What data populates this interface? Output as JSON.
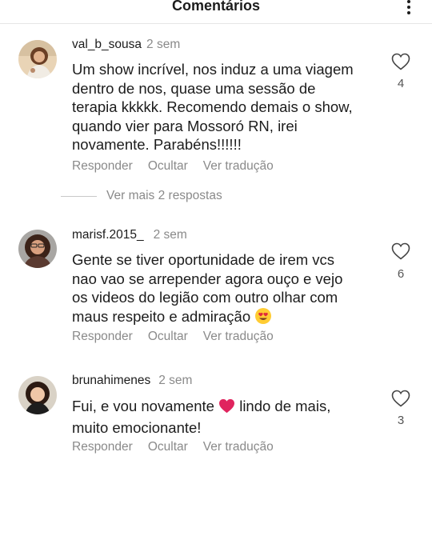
{
  "header": {
    "title": "Comentários"
  },
  "comments": [
    {
      "username": "val_b_sousa",
      "time": "2 sem",
      "text": "Um show incrível, nos induz a uma viagem dentro de nos, quase uma sessão de terapia kkkkk. Recomendo demais o show, quando vier para Mossoró RN, irei novamente. Parabéns!!!!!!",
      "lines": [
        "Um show incrível, nos induz a uma viagem",
        "dentro de nos, quase uma sessão de",
        "terapia kkkkk. Recomendo demais o show,",
        "quando vier para Mossoró RN, irei",
        "novamente. Parabéns!!!!!!"
      ],
      "likes": "4",
      "actions": {
        "reply": "Responder",
        "hide": "Ocultar",
        "translate": "Ver tradução"
      }
    },
    {
      "username": "marisf.2015_",
      "time": "2 sem",
      "text": "Gente se tiver oportunidade de irem vcs nao vao se arrepender agora ouço e vejo os videos do legião com outro olhar com maus respeito e admiração 😍",
      "lines": [
        "Gente se tiver oportunidade de irem vcs",
        "nao vao se arrepender agora ouço e vejo",
        "os videos do legião com outro olhar com",
        "maus respeito e admiração"
      ],
      "emoji": "😍",
      "likes": "6",
      "actions": {
        "reply": "Responder",
        "hide": "Ocultar",
        "translate": "Ver tradução"
      }
    },
    {
      "username": "brunahimenes",
      "time": "2 sem",
      "text": "Fui, e vou novamente ❤️ lindo de mais, muito emocionante!",
      "line1_before": "Fui, e vou novamente",
      "emoji": "❤️",
      "line1_after": "lindo de mais,",
      "line2": "muito emocionante!",
      "likes": "3",
      "actions": {
        "reply": "Responder",
        "hide": "Ocultar",
        "translate": "Ver tradução"
      }
    }
  ],
  "more_replies": "Ver mais 2 respostas",
  "icons": {
    "menu": "more-vertical-icon",
    "like": "heart-outline-icon"
  },
  "colors": {
    "text": "#1c1c1c",
    "muted": "#8a8a8a",
    "divider": "#e6e6e6",
    "emoji_heart": "#e0245e"
  }
}
